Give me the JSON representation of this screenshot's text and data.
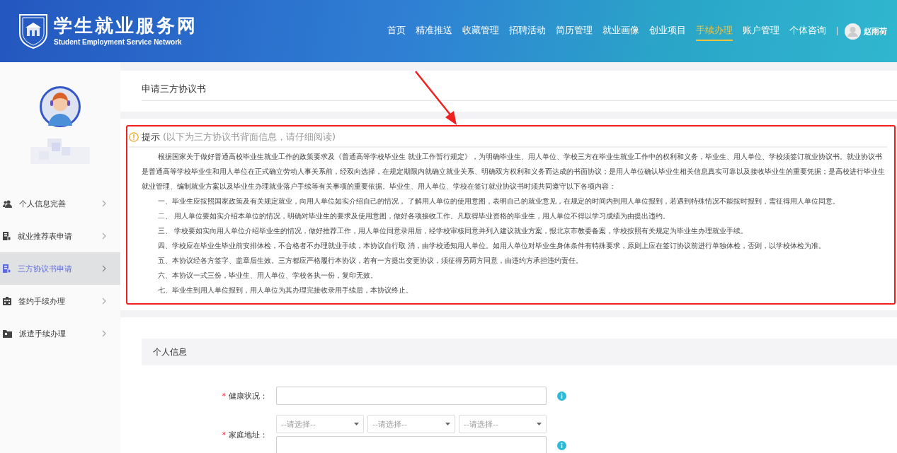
{
  "header": {
    "site_title": "学生就业服务网",
    "site_subtitle": "Student Employment Service Network",
    "nav": [
      {
        "label": "首页",
        "selected": false
      },
      {
        "label": "精准推送",
        "selected": false
      },
      {
        "label": "收藏管理",
        "selected": false
      },
      {
        "label": "招聘活动",
        "selected": false
      },
      {
        "label": "简历管理",
        "selected": false
      },
      {
        "label": "就业画像",
        "selected": false
      },
      {
        "label": "创业项目",
        "selected": false
      },
      {
        "label": "手续办理",
        "selected": true
      },
      {
        "label": "账户管理",
        "selected": false
      },
      {
        "label": "个体咨询",
        "selected": false
      }
    ],
    "user_name": "赵雨荷"
  },
  "sidebar": {
    "items": [
      {
        "label": "个人信息完善",
        "selected": false
      },
      {
        "label": "就业推荐表申请",
        "selected": false
      },
      {
        "label": "三方协议书申请",
        "selected": true
      },
      {
        "label": "签约手续办理",
        "selected": false
      },
      {
        "label": "派遣手续办理",
        "selected": false
      }
    ]
  },
  "page_title": "申请三方协议书",
  "notice": {
    "title": "提示",
    "subtitle": "(以下为三方协议书背面信息，请仔细阅读)",
    "paragraph": "根据国家关于做好普通高校毕业生就业工作的政策要求及《普通高等学校毕业生 就业工作暂行规定》，为明确毕业生、用人单位、学校三方在毕业生就业工作中的权利和义务，毕业生、用人单位、学校须签订就业协议书。就业协议书是普通高等学校毕业生和用人单位在正式确立劳动人事关系前，经双向选择，在规定期限内就确立就业关系、明确双方权利和义务而达成的书面协议；是用人单位确认毕业生相关信息真实可靠以及接收毕业生的重要凭据；是高校进行毕业生就业管理、编制就业方案以及毕业生办理就业落户手续等有关事项的重要依据。毕业生、用人单位、学校在签订就业协议书时须共同遵守以下各项内容：",
    "items": [
      "一、毕业生应按照国家政策及有关规定就业，向用人单位如实介绍自己的情况， 了解用人单位的使用意图，表明自己的就业意见，在规定的时间内到用人单位报到，若遇到特殊情况不能按时报到，需征得用人单位同意。",
      "二、 用人单位要如实介绍本单位的情况，明确对毕业生的要求及使用意图，做好各项接收工作。凡取得毕业资格的毕业生，用人单位不得以学习成绩为由提出违约。",
      "三、 学校要如实向用人单位介绍毕业生的情况，做好推荐工作，用人单位同意录用后，经学校审核同意并列入建议就业方案，报北京市教委备案，学校按照有关规定为毕业生办理就业手续。",
      "四、学校应在毕业生毕业前安排体检，不合格者不办理就业手续，本协议自行取 消，由学校通知用人单位。如用人单位对毕业生身体条件有特殊要求，原则上应在签订协议前进行单独体检，否则，以学校体检为准。",
      "五、本协议经各方签字、盖章后生效。三方都应严格履行本协议，若有一方提出变更协议，须征得另两方同意，由违约方承担违约责任。",
      "六、本协议一式三份，毕业生、用人单位、学校各执一份，复印无效。",
      "七、毕业生到用人单位报到，用人单位为其办理完接收录用手续后，本协议终止。"
    ]
  },
  "section": {
    "title": "个人信息",
    "fields": [
      {
        "kind": "text",
        "required_mark": "*",
        "label": "健康状况："
      },
      {
        "kind": "address",
        "required_mark": "*",
        "label": "家庭地址：",
        "selects": [
          {
            "placeholder": "--请选择--"
          },
          {
            "placeholder": "--请选择--"
          },
          {
            "placeholder": "--请选择--"
          }
        ]
      }
    ]
  }
}
